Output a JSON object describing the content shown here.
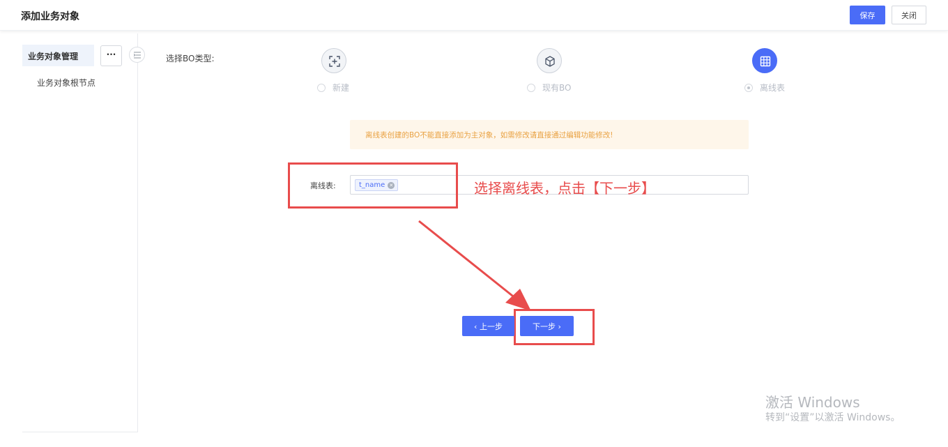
{
  "header": {
    "title": "添加业务对象",
    "save_label": "保存",
    "close_label": "关闭"
  },
  "sidebar": {
    "active_item": "业务对象管理",
    "more_label": "···",
    "node_label": "业务对象根节点"
  },
  "bo_type": {
    "label": "选择BO类型:",
    "options": [
      {
        "label": "新建",
        "icon": "expand-icon",
        "selected": false
      },
      {
        "label": "现有BO",
        "icon": "cube-icon",
        "selected": false
      },
      {
        "label": "离线表",
        "icon": "table-icon",
        "selected": true
      }
    ]
  },
  "notice": {
    "text": "离线表创建的BO不能直接添加为主对象，如需修改请直接通过编辑功能修改!"
  },
  "offline_table": {
    "label": "离线表:",
    "tag": "t_name"
  },
  "annotation": {
    "text": "选择离线表，点击【下一步】",
    "color": "#e84c4c"
  },
  "nav": {
    "prev_label": "上一步",
    "next_label": "下一步"
  },
  "watermark": {
    "line1": "激活 Windows",
    "line2": "转到“设置”以激活 Windows。"
  },
  "colors": {
    "primary": "#4a6cf7",
    "notice_bg": "#fef6ea",
    "notice_text": "#e9a243"
  }
}
